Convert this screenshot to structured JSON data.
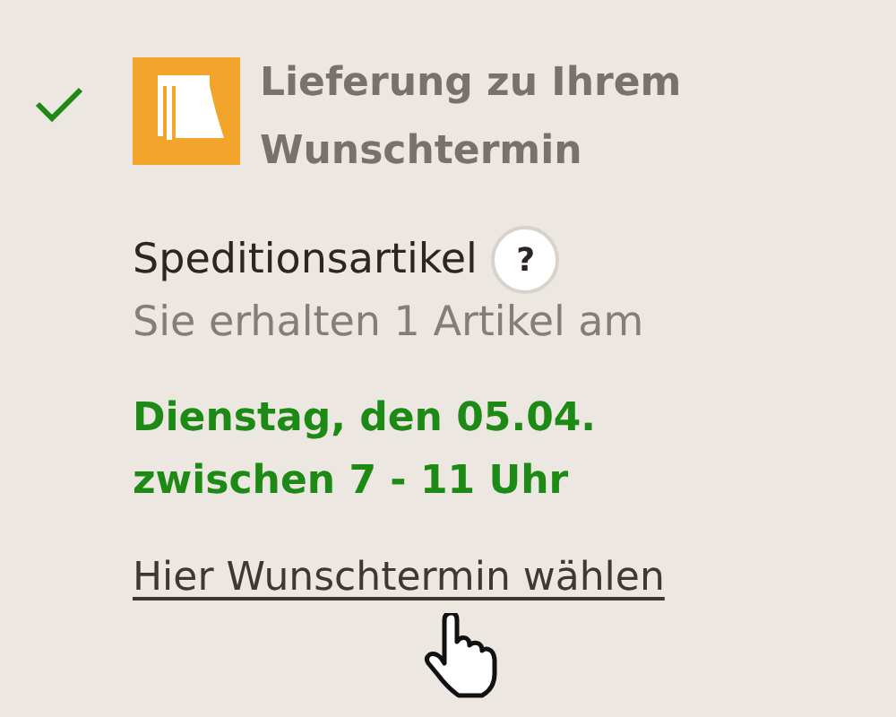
{
  "step": {
    "done": true,
    "title_lines": [
      "Lieferung zu Ihrem",
      "Wunschtermin"
    ]
  },
  "item_label": "Speditionsartikel",
  "help_button": "?",
  "subtitle": "Sie erhalten 1 Artikel am",
  "date_lines": [
    "Dienstag, den 05.04.",
    "zwischen 7 - 11 Uhr"
  ],
  "link": "Hier Wunschtermin wählen"
}
